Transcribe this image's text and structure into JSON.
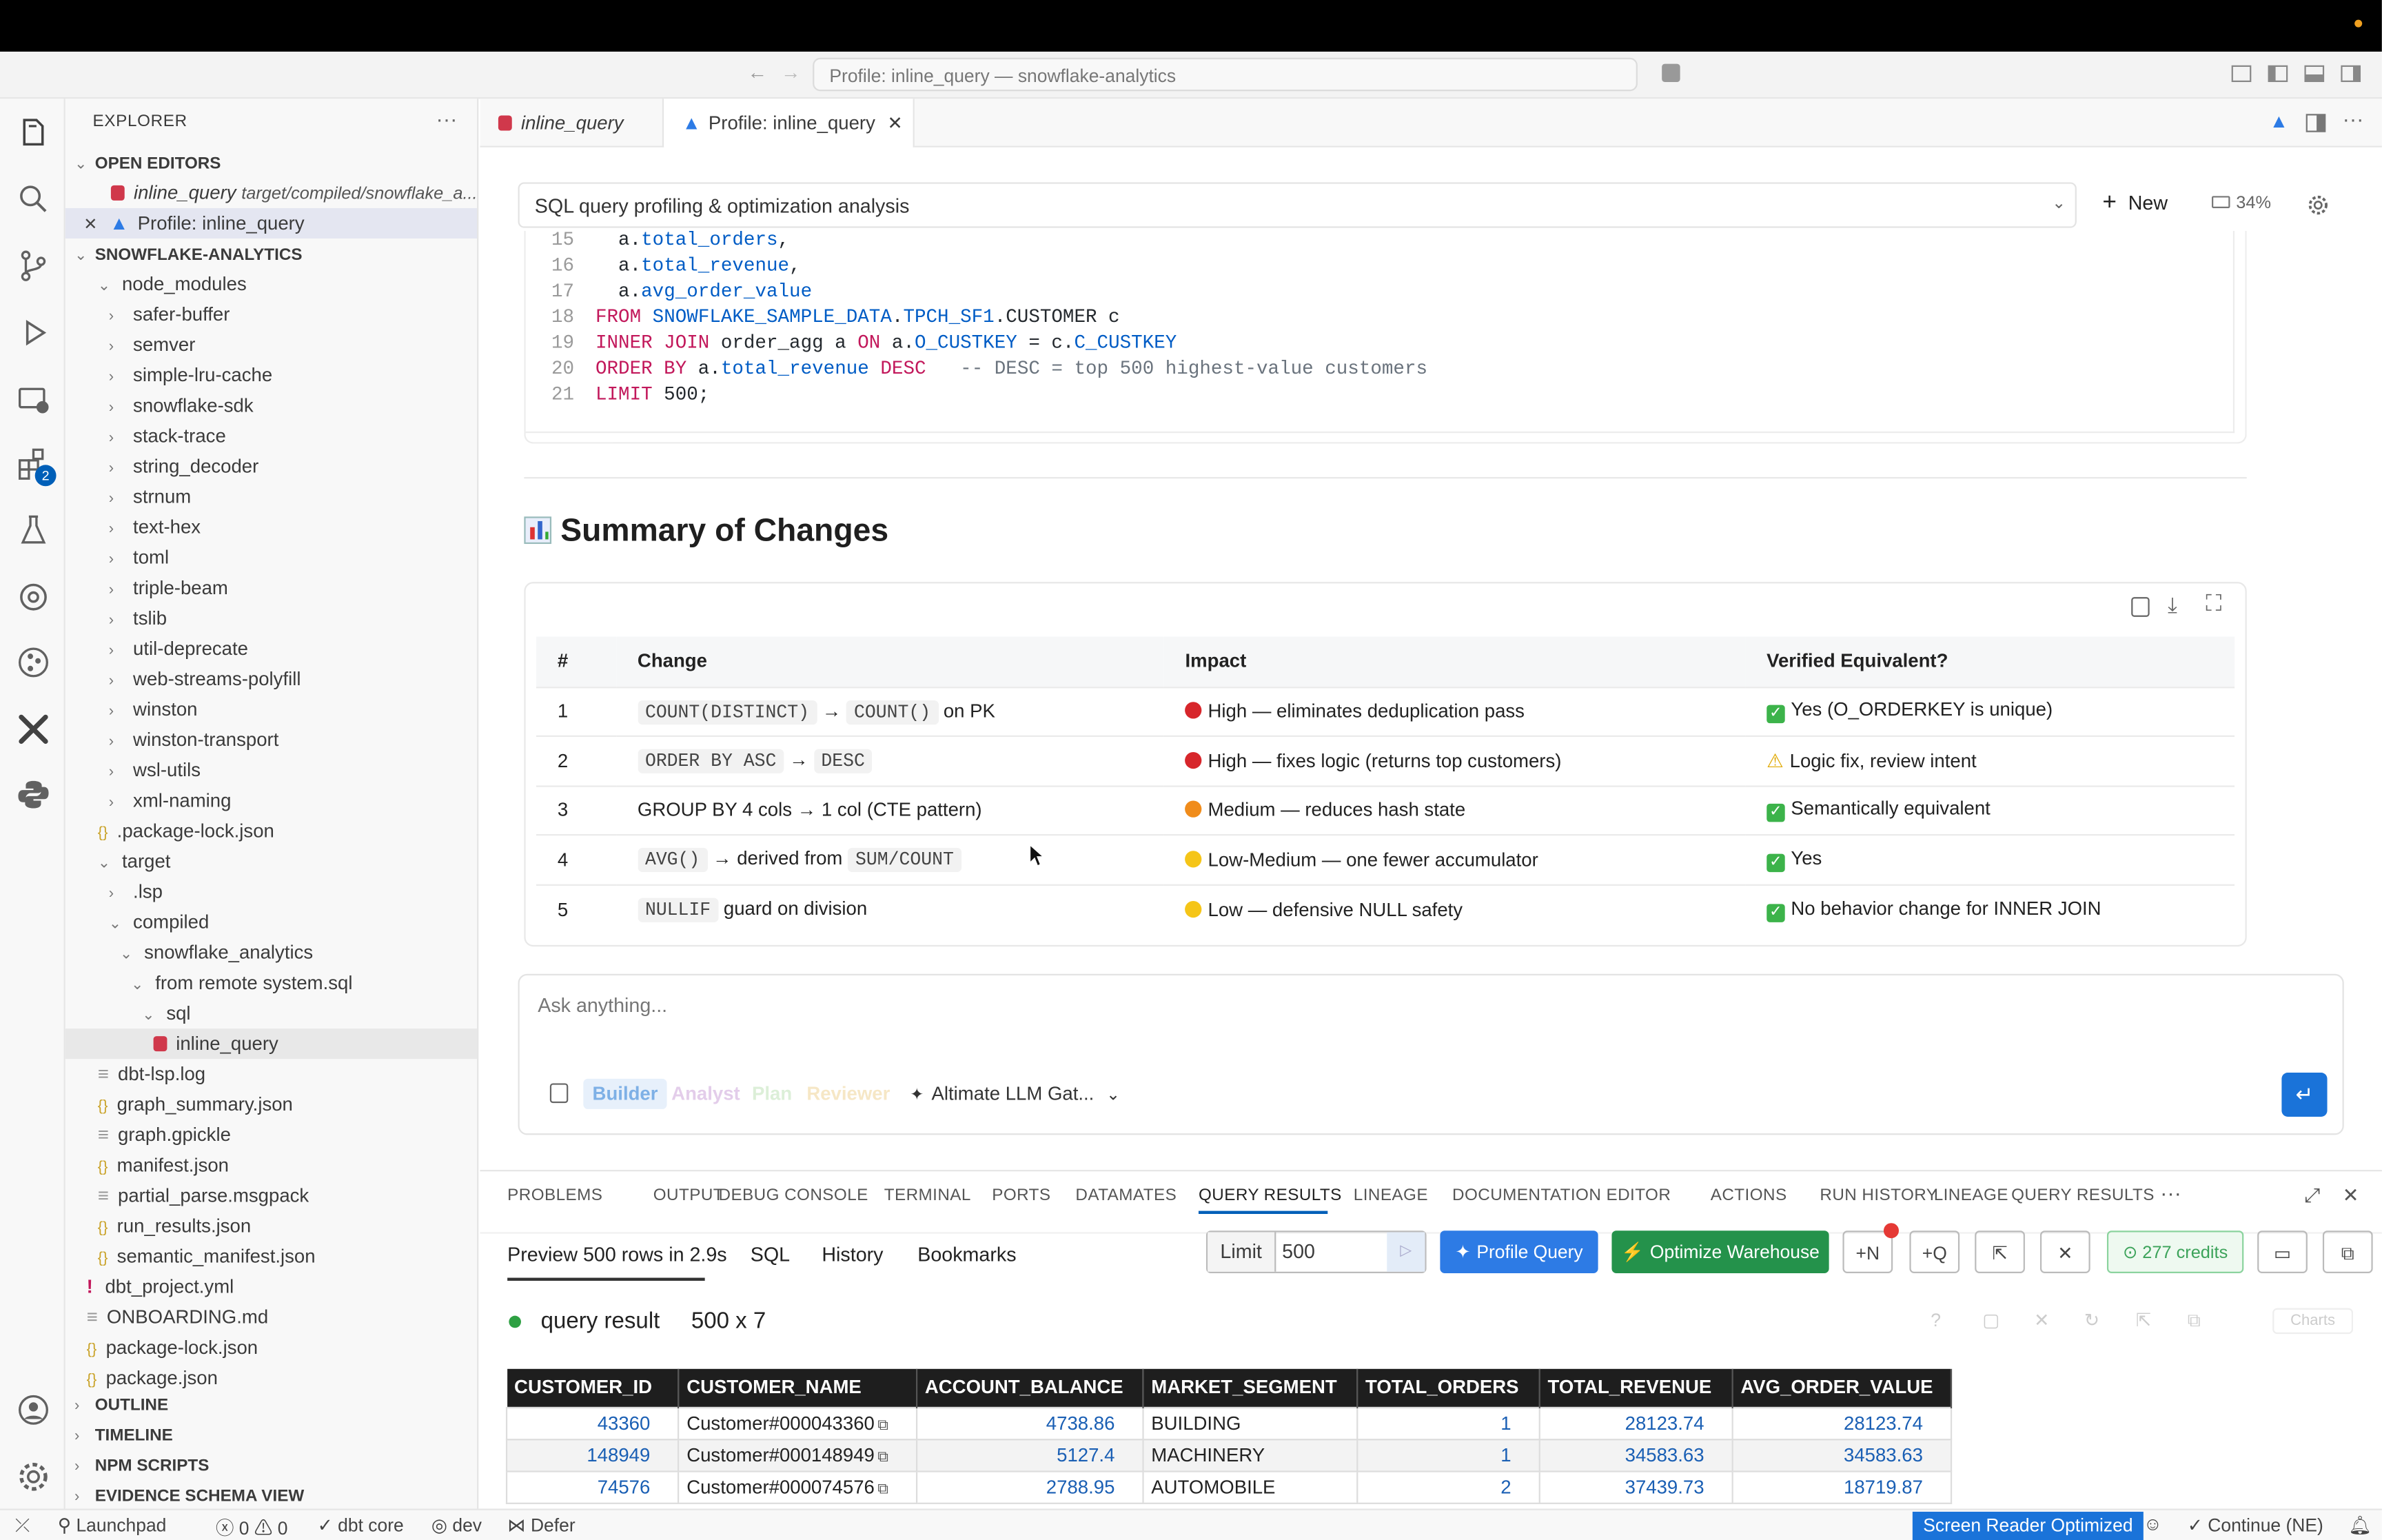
{
  "window": {
    "search": "Profile: inline_query — snowflake-analytics"
  },
  "explorer": {
    "title": "EXPLORER",
    "open_editors": "OPEN EDITORS",
    "open1_name": "inline_query",
    "open1_path": "target/compiled/snowflake_a...",
    "open2_name": "Profile: inline_query",
    "project": "SNOWFLAKE-ANALYTICS",
    "tree": [
      "node_modules",
      "safer-buffer",
      "semver",
      "simple-lru-cache",
      "snowflake-sdk",
      "stack-trace",
      "string_decoder",
      "strnum",
      "text-hex",
      "toml",
      "triple-beam",
      "tslib",
      "util-deprecate",
      "web-streams-polyfill",
      "winston",
      "winston-transport",
      "wsl-utils",
      "xml-naming",
      ".package-lock.json",
      "target",
      ".lsp",
      "compiled",
      "snowflake_analytics",
      "from remote system.sql",
      "sql",
      "inline_query",
      "dbt-lsp.log",
      "graph_summary.json",
      "graph.gpickle",
      "manifest.json",
      "partial_parse.msgpack",
      "run_results.json",
      "semantic_manifest.json",
      "dbt_project.yml",
      "ONBOARDING.md",
      "package-lock.json",
      "package.json"
    ],
    "outline": "OUTLINE",
    "timeline": "TIMELINE",
    "npm": "NPM SCRIPTS",
    "evidence": "EVIDENCE SCHEMA VIEW"
  },
  "badges": {
    "extensions": "2"
  },
  "tabs": {
    "tab1": "inline_query",
    "tab2": "Profile: inline_query"
  },
  "editor": {
    "select": "SQL query profiling & optimization analysis",
    "new_label": "New",
    "usage": "34%",
    "code": [
      {
        "n": "15",
        "t": "  a.total_orders,"
      },
      {
        "n": "16",
        "t": "  a.total_revenue,"
      },
      {
        "n": "17",
        "t": "  a.avg_order_value"
      },
      {
        "n": "18",
        "t": "FROM SNOWFLAKE_SAMPLE_DATA.TPCH_SF1.CUSTOMER c"
      },
      {
        "n": "19",
        "t": "INNER JOIN order_agg a ON a.O_CUSTKEY = c.C_CUSTKEY"
      },
      {
        "n": "20",
        "t": "ORDER BY a.total_revenue DESC   -- DESC = top 500 highest-value customers"
      },
      {
        "n": "21",
        "t": "LIMIT 500;"
      }
    ],
    "summary_title": "Summary of Changes",
    "summary_headers": [
      "#",
      "Change",
      "Impact",
      "Verified Equivalent?"
    ],
    "summary_rows": [
      {
        "n": "1",
        "c_code1": "COUNT(DISTINCT)",
        "c_arrow": "→",
        "c_code2": "COUNT()",
        "c_tail": "on PK",
        "impact": "High — eliminates deduplication pass",
        "impact_color": "#d7262b",
        "ver": "Yes (O_ORDERKEY is unique)",
        "ver_icon": "check"
      },
      {
        "n": "2",
        "c_code1": "ORDER BY ASC",
        "c_arrow": "→",
        "c_code2": "DESC",
        "c_tail": "",
        "impact": "High — fixes logic (returns top customers)",
        "impact_color": "#d7262b",
        "ver": "Logic fix, review intent",
        "ver_icon": "warn"
      },
      {
        "n": "3",
        "c_text": "GROUP BY 4 cols → 1 col (CTE pattern)",
        "impact": "Medium — reduces hash state",
        "impact_color": "#f08c1b",
        "ver": "Semantically equivalent",
        "ver_icon": "check"
      },
      {
        "n": "4",
        "c_code1": "AVG()",
        "c_arrow": "→ derived from",
        "c_code2": "SUM/COUNT",
        "c_tail": "",
        "impact": "Low-Medium — one fewer accumulator",
        "impact_color": "#f5c518",
        "ver": "Yes",
        "ver_icon": "check"
      },
      {
        "n": "5",
        "c_code1": "NULLIF",
        "c_arrow": "",
        "c_code2": "",
        "c_tail": "guard on division",
        "impact": "Low — defensive NULL safety",
        "impact_color": "#f5c518",
        "ver": "No behavior change for INNER JOIN",
        "ver_icon": "check"
      }
    ]
  },
  "chat": {
    "placeholder": "Ask anything...",
    "modes": [
      "Builder",
      "Analyst",
      "Plan",
      "Reviewer"
    ],
    "model": "Altimate LLM Gat..."
  },
  "panel": {
    "tabs": [
      "PROBLEMS",
      "OUTPUT",
      "DEBUG CONSOLE",
      "TERMINAL",
      "PORTS",
      "DATAMATES",
      "QUERY RESULTS",
      "LINEAGE",
      "DOCUMENTATION EDITOR",
      "ACTIONS",
      "RUN HISTORY",
      "LINEAGE",
      "QUERY RESULTS"
    ],
    "subtabs": [
      "Preview 500 rows in 2.9s",
      "SQL",
      "History",
      "Bookmarks"
    ],
    "limit_label": "Limit",
    "limit_value": "500",
    "profile_btn": "Profile Query",
    "optimize_btn": "Optimize Warehouse",
    "n_btn": "+N",
    "q_btn": "+Q",
    "credits": "277 credits",
    "result_label": "query result",
    "result_dims": "500 x 7",
    "charts": "Charts",
    "columns": [
      "CUSTOMER_ID",
      "CUSTOMER_NAME",
      "ACCOUNT_BALANCE",
      "MARKET_SEGMENT",
      "TOTAL_ORDERS",
      "TOTAL_REVENUE",
      "AVG_ORDER_VALUE"
    ],
    "rows": [
      [
        "43360",
        "Customer#000043360",
        "4738.86",
        "BUILDING",
        "1",
        "28123.74",
        "28123.74"
      ],
      [
        "148949",
        "Customer#000148949",
        "5127.4",
        "MACHINERY",
        "1",
        "34583.63",
        "34583.63"
      ],
      [
        "74576",
        "Customer#000074576",
        "2788.95",
        "AUTOMOBILE",
        "2",
        "37439.73",
        "18719.87"
      ]
    ]
  },
  "status": {
    "launchpad": "Launchpad",
    "errors": "0",
    "warnings": "0",
    "dbt": "dbt core",
    "env": "dev",
    "defer": "Defer",
    "reader": "Screen Reader Optimized",
    "cont": "Continue (NE)"
  }
}
